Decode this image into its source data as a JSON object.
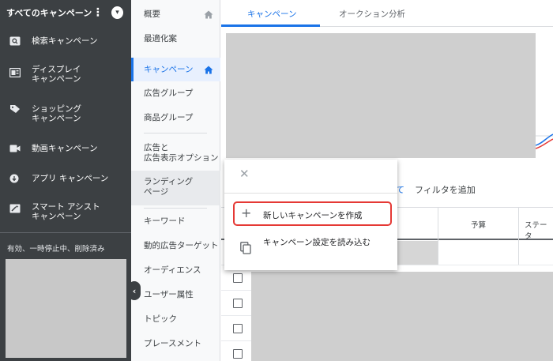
{
  "sidebar": {
    "header_title": "すべてのキャンペーン",
    "menu_glyph": "⋮",
    "dropdown_glyph": "▾",
    "items": [
      {
        "label": "検索キャンペーン",
        "icon": "search-icon"
      },
      {
        "label": "ディスプレイ\nキャンペーン",
        "icon": "display-icon"
      },
      {
        "label": "ショッピング\nキャンペーン",
        "icon": "shopping-tag-icon"
      },
      {
        "label": "動画キャンペーン",
        "icon": "video-icon"
      },
      {
        "label": "アプリ キャンペーン",
        "icon": "app-icon"
      },
      {
        "label": "スマート アシスト\nキャンペーン",
        "icon": "smart-assist-icon"
      }
    ],
    "status_filter": "有効、一時停止中、削除済み",
    "collapse_glyph": "‹"
  },
  "subnav": {
    "items": [
      {
        "label": "概要"
      },
      {
        "label": "最適化案"
      },
      {
        "label": "キャンペーン"
      },
      {
        "label": "広告グループ"
      },
      {
        "label": "商品グループ"
      },
      {
        "label": "広告と\n広告表示オプション"
      },
      {
        "label": "ランディング\nページ"
      },
      {
        "label": "キーワード"
      },
      {
        "label": "動的広告ターゲット"
      },
      {
        "label": "オーディエンス"
      },
      {
        "label": "ユーザー属性"
      },
      {
        "label": "トピック"
      },
      {
        "label": "プレースメント"
      }
    ]
  },
  "main": {
    "tabs": [
      {
        "label": "キャンペーン"
      },
      {
        "label": "オークション分析"
      }
    ],
    "filter_link": "て",
    "filter_add": "フィルタを追加",
    "table": {
      "headers": [
        "予算",
        "ステータ"
      ]
    }
  },
  "popup": {
    "close_glyph": "✕",
    "new_campaign": "新しいキャンペーンを作成",
    "plus_glyph": "+",
    "load_settings": "キャンペーン設定を読み込む"
  },
  "colors": {
    "sidebar_bg": "#3c4043",
    "accent_blue": "#1a73e8",
    "highlight_red": "#e53935"
  }
}
